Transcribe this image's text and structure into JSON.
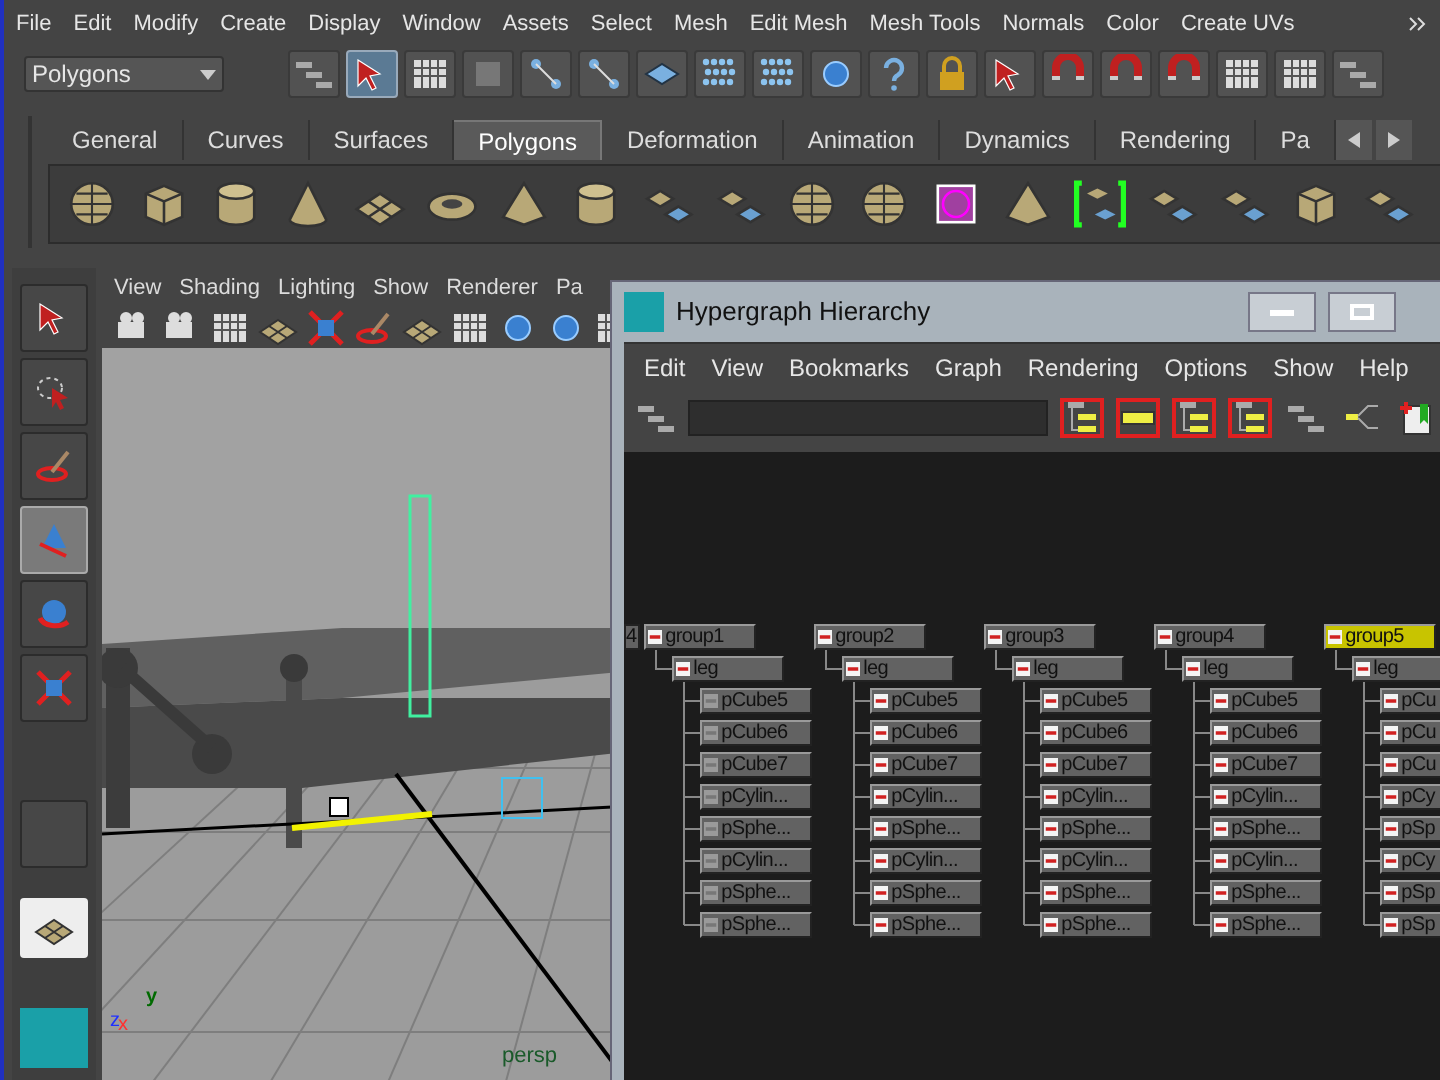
{
  "menu_bar": [
    "File",
    "Edit",
    "Modify",
    "Create",
    "Display",
    "Window",
    "Assets",
    "Select",
    "Mesh",
    "Edit Mesh",
    "Mesh Tools",
    "Normals",
    "Color",
    "Create UVs"
  ],
  "status_line": {
    "menu_set": "Polygons"
  },
  "shelf": {
    "tabs": [
      {
        "label": "General",
        "selected": false
      },
      {
        "label": "Curves",
        "selected": false
      },
      {
        "label": "Surfaces",
        "selected": false
      },
      {
        "label": "Polygons",
        "selected": true
      },
      {
        "label": "Deformation",
        "selected": false
      },
      {
        "label": "Animation",
        "selected": false
      },
      {
        "label": "Dynamics",
        "selected": false
      },
      {
        "label": "Rendering",
        "selected": false
      },
      {
        "label": "Pa",
        "selected": false
      }
    ]
  },
  "toolbox": [
    {
      "selected": false
    },
    {
      "selected": false
    },
    {
      "selected": false
    },
    {
      "selected": true
    },
    {
      "selected": false
    },
    {
      "selected": false
    }
  ],
  "viewport": {
    "menu": [
      "View",
      "Shading",
      "Lighting",
      "Show",
      "Renderer",
      "Pa"
    ],
    "camera": "persp",
    "axes": [
      "y",
      "z",
      "x"
    ]
  },
  "hypergraph": {
    "title": "Hypergraph Hierarchy",
    "menu": [
      "Edit",
      "View",
      "Bookmarks",
      "Graph",
      "Rendering",
      "Options",
      "Show",
      "Help"
    ],
    "toolbar_toggles": [
      {
        "on": true
      },
      {
        "on": true
      },
      {
        "on": true
      },
      {
        "on": true
      },
      {
        "on": false
      },
      {
        "on": false
      }
    ],
    "cut_node": "4",
    "groups": [
      {
        "name": "group1",
        "selected": false,
        "children": [
          {
            "name": "leg",
            "children": [
              {
                "name": "pCube5",
                "dimmed": true
              },
              {
                "name": "pCube6",
                "dimmed": true
              },
              {
                "name": "pCube7",
                "dimmed": true
              },
              {
                "name": "pCylin...",
                "dimmed": true
              },
              {
                "name": "pSphe...",
                "dimmed": true
              },
              {
                "name": "pCylin...",
                "dimmed": true
              },
              {
                "name": "pSphe...",
                "dimmed": true
              },
              {
                "name": "pSphe...",
                "dimmed": true
              }
            ]
          }
        ]
      },
      {
        "name": "group2",
        "selected": false,
        "children": [
          {
            "name": "leg",
            "children": [
              {
                "name": "pCube5",
                "dimmed": false
              },
              {
                "name": "pCube6",
                "dimmed": false
              },
              {
                "name": "pCube7",
                "dimmed": false
              },
              {
                "name": "pCylin...",
                "dimmed": false
              },
              {
                "name": "pSphe...",
                "dimmed": false
              },
              {
                "name": "pCylin...",
                "dimmed": false
              },
              {
                "name": "pSphe...",
                "dimmed": false
              },
              {
                "name": "pSphe...",
                "dimmed": false
              }
            ]
          }
        ]
      },
      {
        "name": "group3",
        "selected": false,
        "children": [
          {
            "name": "leg",
            "children": [
              {
                "name": "pCube5",
                "dimmed": false
              },
              {
                "name": "pCube6",
                "dimmed": false
              },
              {
                "name": "pCube7",
                "dimmed": false
              },
              {
                "name": "pCylin...",
                "dimmed": false
              },
              {
                "name": "pSphe...",
                "dimmed": false
              },
              {
                "name": "pCylin...",
                "dimmed": false
              },
              {
                "name": "pSphe...",
                "dimmed": false
              },
              {
                "name": "pSphe...",
                "dimmed": false
              }
            ]
          }
        ]
      },
      {
        "name": "group4",
        "selected": false,
        "children": [
          {
            "name": "leg",
            "children": [
              {
                "name": "pCube5",
                "dimmed": false
              },
              {
                "name": "pCube6",
                "dimmed": false
              },
              {
                "name": "pCube7",
                "dimmed": false
              },
              {
                "name": "pCylin...",
                "dimmed": false
              },
              {
                "name": "pSphe...",
                "dimmed": false
              },
              {
                "name": "pCylin...",
                "dimmed": false
              },
              {
                "name": "pSphe...",
                "dimmed": false
              },
              {
                "name": "pSphe...",
                "dimmed": false
              }
            ]
          }
        ]
      },
      {
        "name": "group5",
        "selected": true,
        "children": [
          {
            "name": "leg",
            "children": [
              {
                "name": "pCu",
                "dimmed": false
              },
              {
                "name": "pCu",
                "dimmed": false
              },
              {
                "name": "pCu",
                "dimmed": false
              },
              {
                "name": "pCy",
                "dimmed": false
              },
              {
                "name": "pSp",
                "dimmed": false
              },
              {
                "name": "pCy",
                "dimmed": false
              },
              {
                "name": "pSp",
                "dimmed": false
              },
              {
                "name": "pSp",
                "dimmed": false
              }
            ]
          }
        ]
      }
    ]
  }
}
